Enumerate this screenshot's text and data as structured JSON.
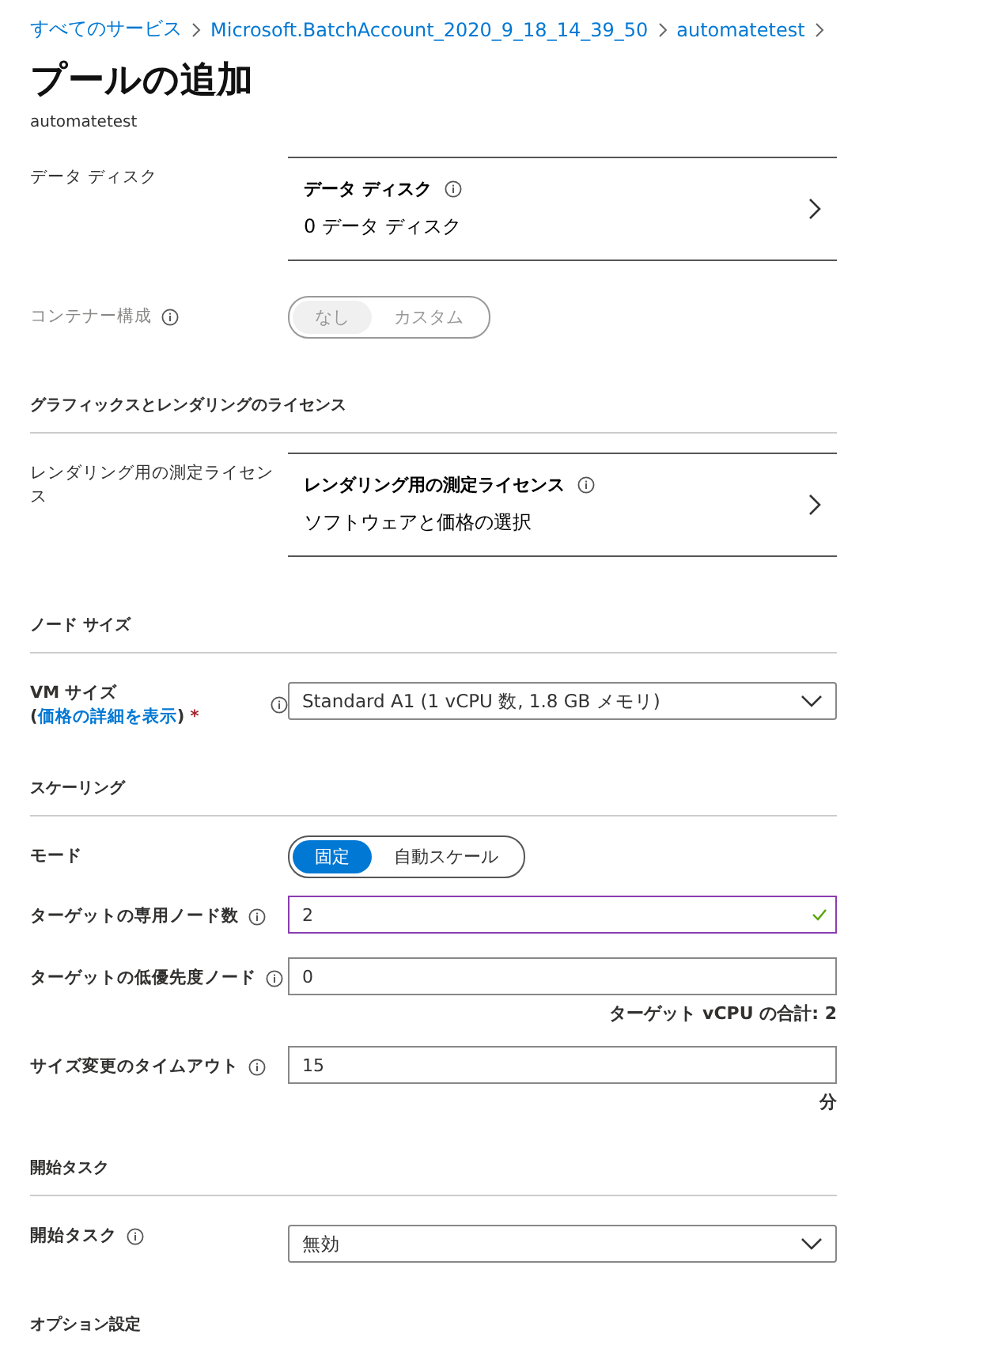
{
  "breadcrumb": [
    {
      "label": "すべてのサービス"
    },
    {
      "label": "Microsoft.BatchAccount_2020_9_18_14_39_50"
    },
    {
      "label": "automatetest"
    }
  ],
  "title": "プールの追加",
  "subtitle": "automatetest",
  "rows": [
    {
      "kind": "link-row",
      "label": "データ ディスク",
      "card_title": "データ ディスク",
      "card_value": "0 データ ディスク"
    },
    {
      "kind": "toggle",
      "label": "コンテナー構成",
      "info": true,
      "disabled": true,
      "options": [
        {
          "label": "なし",
          "selected": true
        },
        {
          "label": "カスタム",
          "selected": false
        }
      ]
    },
    {
      "kind": "section",
      "label": "グラフィックスとレンダリングのライセンス"
    },
    {
      "kind": "link-row",
      "label": "レンダリング用の測定ライセンス",
      "card_title": "レンダリング用の測定ライセンス",
      "card_value": "ソフトウェアと価格の選択"
    },
    {
      "kind": "section",
      "label": "ノード サイズ"
    },
    {
      "kind": "select",
      "label": "VM サイズ (",
      "link": "価格の詳細を表示",
      "label_end": ")",
      "required_mark": "*",
      "info": true,
      "value": "Standard A1 (1 vCPU 数, 1.8 GB メモリ)"
    },
    {
      "kind": "section",
      "label": "スケーリング"
    },
    {
      "kind": "toggle",
      "label": "モード",
      "disabled": false,
      "options": [
        {
          "label": "固定",
          "selected": true
        },
        {
          "label": "自動スケール",
          "selected": false
        }
      ]
    },
    {
      "kind": "input",
      "label": "ターゲットの専用ノード数",
      "info": true,
      "value": "2",
      "valid": true
    },
    {
      "kind": "input",
      "label": "ターゲットの低優先度ノード",
      "info": true,
      "value": "0",
      "valid": false,
      "note": "ターゲット vCPU の合計: 2"
    },
    {
      "kind": "input",
      "label": "サイズ変更のタイムアウト",
      "info": true,
      "value": "15",
      "valid": false,
      "note": "分"
    },
    {
      "kind": "section",
      "label": "開始タスク"
    },
    {
      "kind": "select",
      "label": "開始タスク",
      "info": true,
      "value": "無効"
    },
    {
      "kind": "section",
      "label": "オプション設定"
    }
  ]
}
